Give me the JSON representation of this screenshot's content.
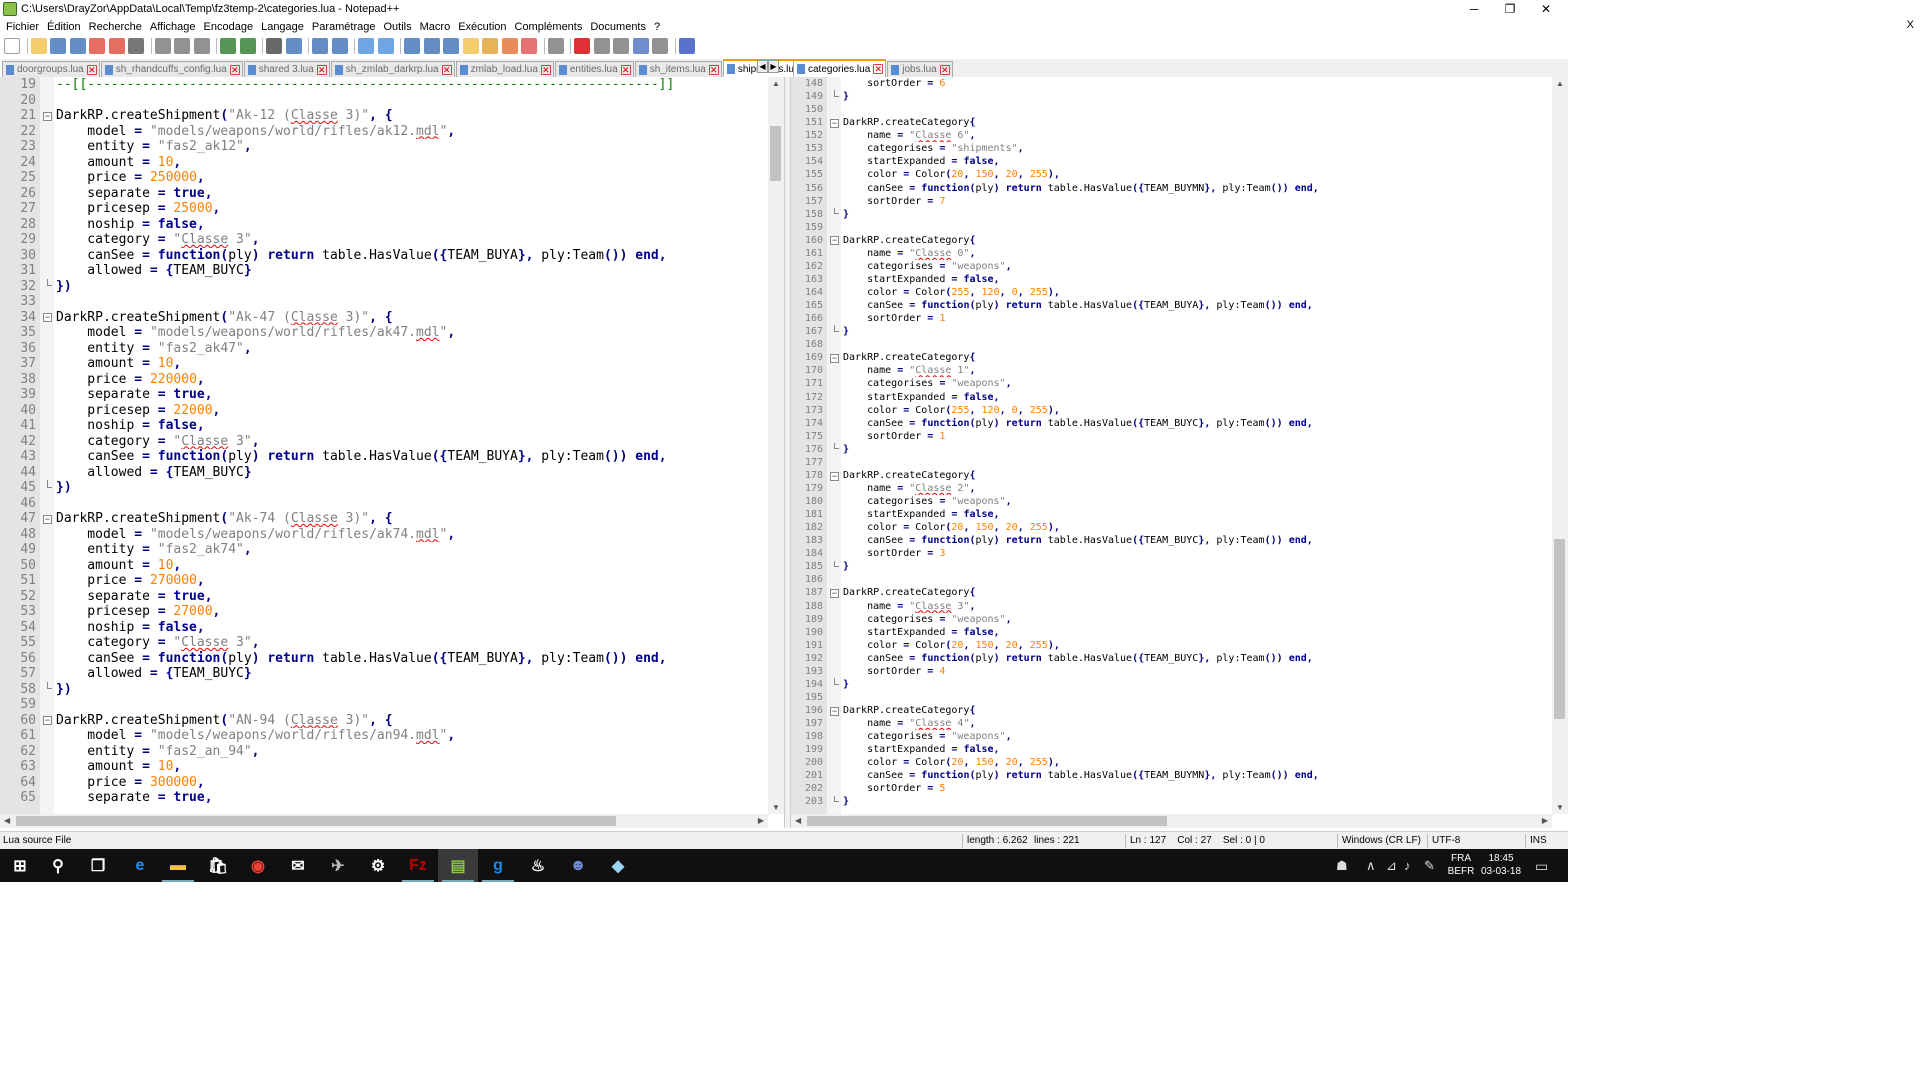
{
  "window": {
    "title": "C:\\Users\\DrayZor\\AppData\\Local\\Temp\\fz3temp-2\\categories.lua - Notepad++",
    "minimize": "─",
    "maximize": "❐",
    "close": "✕"
  },
  "menu": {
    "items": [
      "Fichier",
      "Édition",
      "Recherche",
      "Affichage",
      "Encodage",
      "Langage",
      "Paramétrage",
      "Outils",
      "Macro",
      "Exécution",
      "Compléments",
      "Documents",
      "?"
    ],
    "close": "X"
  },
  "toolbar": {
    "icons": [
      "new-file-icon",
      "open-file-icon",
      "save-icon",
      "save-all-icon",
      "close-icon",
      "close-all-icon",
      "print-icon",
      "cut-icon",
      "copy-icon",
      "paste-icon",
      "undo-icon",
      "redo-icon",
      "find-icon",
      "replace-icon",
      "zoom-in-icon",
      "zoom-out-icon",
      "sync-vertical-icon",
      "sync-horizontal-icon",
      "word-wrap-icon",
      "show-all-chars-icon",
      "indent-guide-icon",
      "user-language-icon",
      "doc-map-icon",
      "function-list-icon",
      "folder-workspace-icon",
      "monitoring-icon",
      "record-macro-icon",
      "stop-macro-icon",
      "play-macro-icon",
      "run-macro-multiple-icon",
      "save-macro-icon",
      "spellcheck-icon"
    ],
    "colors": [
      "#ffffff",
      "#f3c14a",
      "#3d6fb6",
      "#3d6fb6",
      "#e04a3a",
      "#e04a3a",
      "#555555",
      "#777777",
      "#777777",
      "#777777",
      "#2a7a2a",
      "#2a7a2a",
      "#444444",
      "#3d6fb6",
      "#3d6fb6",
      "#3d6fb6",
      "#4a90d9",
      "#4a90d9",
      "#3d6fb6",
      "#3d6fb6",
      "#3d6fb6",
      "#f3c14a",
      "#e0a030",
      "#e07030",
      "#e05050",
      "#777777",
      "#d00000",
      "#777777",
      "#777777",
      "#4a70c0",
      "#777777",
      "#3050c0"
    ]
  },
  "left_tabs": [
    {
      "name": "doorgroups.lua",
      "active": false
    },
    {
      "name": "sh_rhandcuffs_config.lua",
      "active": false
    },
    {
      "name": "shared 3.lua",
      "active": false
    },
    {
      "name": "sh_zmlab_darkrp.lua",
      "active": false
    },
    {
      "name": "zmlab_load.lua",
      "active": false
    },
    {
      "name": "entities.lua",
      "active": false
    },
    {
      "name": "sh_items.lua",
      "active": false
    },
    {
      "name": "shipments.lua",
      "active": true
    }
  ],
  "right_tabs": [
    {
      "name": "categories.lua",
      "active": true
    },
    {
      "name": "jobs.lua",
      "active": false
    }
  ],
  "tab_nav": {
    "prev": "◀",
    "next": "▶"
  },
  "left_editor": {
    "lines": [
      {
        "n": "19",
        "c": "--[[-------------------------------------------------------------------------]]",
        "f": ""
      },
      {
        "n": "20",
        "c": "",
        "f": ""
      },
      {
        "n": "21",
        "c": "DarkRP.createShipment(\"Ak-12 (Classe 3)\", {",
        "f": "⊟"
      },
      {
        "n": "22",
        "c": "    model = \"models/weapons/world/rifles/ak12.mdl\",",
        "f": ""
      },
      {
        "n": "23",
        "c": "    entity = \"fas2_ak12\",",
        "f": ""
      },
      {
        "n": "24",
        "c": "    amount = 10,",
        "f": ""
      },
      {
        "n": "25",
        "c": "    price = 250000,",
        "f": ""
      },
      {
        "n": "26",
        "c": "    separate = true,",
        "f": ""
      },
      {
        "n": "27",
        "c": "    pricesep = 25000,",
        "f": ""
      },
      {
        "n": "28",
        "c": "    noship = false,",
        "f": ""
      },
      {
        "n": "29",
        "c": "    category = \"Classe 3\",",
        "f": ""
      },
      {
        "n": "30",
        "c": "    canSee = function(ply) return table.HasValue({TEAM_BUYA}, ply:Team()) end,",
        "f": ""
      },
      {
        "n": "31",
        "c": "    allowed = {TEAM_BUYC}",
        "f": ""
      },
      {
        "n": "32",
        "c": "})",
        "f": "└"
      },
      {
        "n": "33",
        "c": "",
        "f": ""
      },
      {
        "n": "34",
        "c": "DarkRP.createShipment(\"Ak-47 (Classe 3)\", {",
        "f": "⊟"
      },
      {
        "n": "35",
        "c": "    model = \"models/weapons/world/rifles/ak47.mdl\",",
        "f": ""
      },
      {
        "n": "36",
        "c": "    entity = \"fas2_ak47\",",
        "f": ""
      },
      {
        "n": "37",
        "c": "    amount = 10,",
        "f": ""
      },
      {
        "n": "38",
        "c": "    price = 220000,",
        "f": ""
      },
      {
        "n": "39",
        "c": "    separate = true,",
        "f": ""
      },
      {
        "n": "40",
        "c": "    pricesep = 22000,",
        "f": ""
      },
      {
        "n": "41",
        "c": "    noship = false,",
        "f": ""
      },
      {
        "n": "42",
        "c": "    category = \"Classe 3\",",
        "f": ""
      },
      {
        "n": "43",
        "c": "    canSee = function(ply) return table.HasValue({TEAM_BUYA}, ply:Team()) end,",
        "f": ""
      },
      {
        "n": "44",
        "c": "    allowed = {TEAM_BUYC}",
        "f": ""
      },
      {
        "n": "45",
        "c": "})",
        "f": "└"
      },
      {
        "n": "46",
        "c": "",
        "f": ""
      },
      {
        "n": "47",
        "c": "DarkRP.createShipment(\"Ak-74 (Classe 3)\", {",
        "f": "⊟"
      },
      {
        "n": "48",
        "c": "    model = \"models/weapons/world/rifles/ak74.mdl\",",
        "f": ""
      },
      {
        "n": "49",
        "c": "    entity = \"fas2_ak74\",",
        "f": ""
      },
      {
        "n": "50",
        "c": "    amount = 10,",
        "f": ""
      },
      {
        "n": "51",
        "c": "    price = 270000,",
        "f": ""
      },
      {
        "n": "52",
        "c": "    separate = true,",
        "f": ""
      },
      {
        "n": "53",
        "c": "    pricesep = 27000,",
        "f": ""
      },
      {
        "n": "54",
        "c": "    noship = false,",
        "f": ""
      },
      {
        "n": "55",
        "c": "    category = \"Classe 3\",",
        "f": ""
      },
      {
        "n": "56",
        "c": "    canSee = function(ply) return table.HasValue({TEAM_BUYA}, ply:Team()) end,",
        "f": ""
      },
      {
        "n": "57",
        "c": "    allowed = {TEAM_BUYC}",
        "f": ""
      },
      {
        "n": "58",
        "c": "})",
        "f": "└"
      },
      {
        "n": "59",
        "c": "",
        "f": ""
      },
      {
        "n": "60",
        "c": "DarkRP.createShipment(\"AN-94 (Classe 3)\", {",
        "f": "⊟"
      },
      {
        "n": "61",
        "c": "    model = \"models/weapons/world/rifles/an94.mdl\",",
        "f": ""
      },
      {
        "n": "62",
        "c": "    entity = \"fas2_an_94\",",
        "f": ""
      },
      {
        "n": "63",
        "c": "    amount = 10,",
        "f": ""
      },
      {
        "n": "64",
        "c": "    price = 300000,",
        "f": ""
      },
      {
        "n": "65",
        "c": "    separate = true,",
        "f": ""
      }
    ]
  },
  "right_editor": {
    "lines": [
      {
        "n": "148",
        "c": "    sortOrder = 6",
        "f": ""
      },
      {
        "n": "149",
        "c": "}",
        "f": "└"
      },
      {
        "n": "150",
        "c": "",
        "f": ""
      },
      {
        "n": "151",
        "c": "DarkRP.createCategory{",
        "f": "⊟"
      },
      {
        "n": "152",
        "c": "    name = \"Classe 6\",",
        "f": ""
      },
      {
        "n": "153",
        "c": "    categorises = \"shipments\",",
        "f": ""
      },
      {
        "n": "154",
        "c": "    startExpanded = false,",
        "f": ""
      },
      {
        "n": "155",
        "c": "    color = Color(20, 150, 20, 255),",
        "f": ""
      },
      {
        "n": "156",
        "c": "    canSee = function(ply) return table.HasValue({TEAM_BUYMN}, ply:Team()) end,",
        "f": ""
      },
      {
        "n": "157",
        "c": "    sortOrder = 7",
        "f": ""
      },
      {
        "n": "158",
        "c": "}",
        "f": "└"
      },
      {
        "n": "159",
        "c": "",
        "f": ""
      },
      {
        "n": "160",
        "c": "DarkRP.createCategory{",
        "f": "⊟"
      },
      {
        "n": "161",
        "c": "    name = \"Classe 0\",",
        "f": ""
      },
      {
        "n": "162",
        "c": "    categorises = \"weapons\",",
        "f": ""
      },
      {
        "n": "163",
        "c": "    startExpanded = false,",
        "f": ""
      },
      {
        "n": "164",
        "c": "    color = Color(255, 120, 0, 255),",
        "f": ""
      },
      {
        "n": "165",
        "c": "    canSee = function(ply) return table.HasValue({TEAM_BUYA}, ply:Team()) end,",
        "f": ""
      },
      {
        "n": "166",
        "c": "    sortOrder = 1",
        "f": ""
      },
      {
        "n": "167",
        "c": "}",
        "f": "└"
      },
      {
        "n": "168",
        "c": "",
        "f": ""
      },
      {
        "n": "169",
        "c": "DarkRP.createCategory{",
        "f": "⊟"
      },
      {
        "n": "170",
        "c": "    name = \"Classe 1\",",
        "f": ""
      },
      {
        "n": "171",
        "c": "    categorises = \"weapons\",",
        "f": ""
      },
      {
        "n": "172",
        "c": "    startExpanded = false,",
        "f": ""
      },
      {
        "n": "173",
        "c": "    color = Color(255, 120, 0, 255),",
        "f": ""
      },
      {
        "n": "174",
        "c": "    canSee = function(ply) return table.HasValue({TEAM_BUYC}, ply:Team()) end,",
        "f": ""
      },
      {
        "n": "175",
        "c": "    sortOrder = 1",
        "f": ""
      },
      {
        "n": "176",
        "c": "}",
        "f": "└"
      },
      {
        "n": "177",
        "c": "",
        "f": ""
      },
      {
        "n": "178",
        "c": "DarkRP.createCategory{",
        "f": "⊟"
      },
      {
        "n": "179",
        "c": "    name = \"Classe 2\",",
        "f": ""
      },
      {
        "n": "180",
        "c": "    categorises = \"weapons\",",
        "f": ""
      },
      {
        "n": "181",
        "c": "    startExpanded = false,",
        "f": ""
      },
      {
        "n": "182",
        "c": "    color = Color(20, 150, 20, 255),",
        "f": ""
      },
      {
        "n": "183",
        "c": "    canSee = function(ply) return table.HasValue({TEAM_BUYC}, ply:Team()) end,",
        "f": ""
      },
      {
        "n": "184",
        "c": "    sortOrder = 3",
        "f": ""
      },
      {
        "n": "185",
        "c": "}",
        "f": "└"
      },
      {
        "n": "186",
        "c": "",
        "f": ""
      },
      {
        "n": "187",
        "c": "DarkRP.createCategory{",
        "f": "⊟"
      },
      {
        "n": "188",
        "c": "    name = \"Classe 3\",",
        "f": ""
      },
      {
        "n": "189",
        "c": "    categorises = \"weapons\",",
        "f": ""
      },
      {
        "n": "190",
        "c": "    startExpanded = false,",
        "f": ""
      },
      {
        "n": "191",
        "c": "    color = Color(20, 150, 20, 255),",
        "f": ""
      },
      {
        "n": "192",
        "c": "    canSee = function(ply) return table.HasValue({TEAM_BUYC}, ply:Team()) end,",
        "f": ""
      },
      {
        "n": "193",
        "c": "    sortOrder = 4",
        "f": ""
      },
      {
        "n": "194",
        "c": "}",
        "f": "└"
      },
      {
        "n": "195",
        "c": "",
        "f": ""
      },
      {
        "n": "196",
        "c": "DarkRP.createCategory{",
        "f": "⊟"
      },
      {
        "n": "197",
        "c": "    name = \"Classe 4\",",
        "f": ""
      },
      {
        "n": "198",
        "c": "    categorises = \"weapons\",",
        "f": ""
      },
      {
        "n": "199",
        "c": "    startExpanded = false,",
        "f": ""
      },
      {
        "n": "200",
        "c": "    color = Color(20, 150, 20, 255),",
        "f": ""
      },
      {
        "n": "201",
        "c": "    canSee = function(ply) return table.HasValue({TEAM_BUYMN}, ply:Team()) end,",
        "f": ""
      },
      {
        "n": "202",
        "c": "    sortOrder = 5",
        "f": ""
      },
      {
        "n": "203",
        "c": "}",
        "f": "└"
      }
    ]
  },
  "scroll": {
    "up": "▲",
    "down": "▼",
    "left": "◀",
    "right": "▶",
    "left_v": 0.05,
    "right_v": 0.85,
    "left_h": 0.0,
    "right_h": 0.0
  },
  "statusbar": {
    "filetype": "Lua source File",
    "length": "length : 6.262",
    "lines": "lines : 221",
    "position": "Ln : 127    Col : 27    Sel : 0 | 0",
    "eol": "Windows (CR LF)",
    "encoding": "UTF-8",
    "mode": "INS"
  },
  "taskbar": {
    "apps": [
      "windows-start-icon",
      "search-icon",
      "task-view-icon",
      "edge-icon",
      "file-explorer-icon",
      "store-icon",
      "chrome-icon",
      "mail-icon",
      "game-app-icon",
      "steam-controller-icon",
      "filezilla-icon",
      "notepadpp-icon",
      "gmod-icon",
      "steam-icon",
      "discord-icon",
      "crystal-app-icon"
    ],
    "glyphs": [
      "⊞",
      "⚲",
      "❐",
      "e",
      "▬",
      "🛍",
      "◉",
      "✉",
      "✈",
      "⚙",
      "Fz",
      "▤",
      "g",
      "♨",
      "☻",
      "◆"
    ],
    "lang": "FRA",
    "layout": "BEFR",
    "time": "18:45",
    "date": "03-03-18",
    "tray": [
      "people-icon",
      "chevron-up-icon",
      "network-icon",
      "volume-icon",
      "pen-icon"
    ],
    "tray_glyphs": [
      "☗",
      "∧",
      "⊿",
      "♪",
      "✎"
    ],
    "notifications": "▭"
  },
  "colors": {
    "keyword": "#00008b",
    "string": "#808080",
    "number": "#ff8000",
    "operator": "#000080",
    "comment": "#008000",
    "active_tab": "#f4a000"
  }
}
